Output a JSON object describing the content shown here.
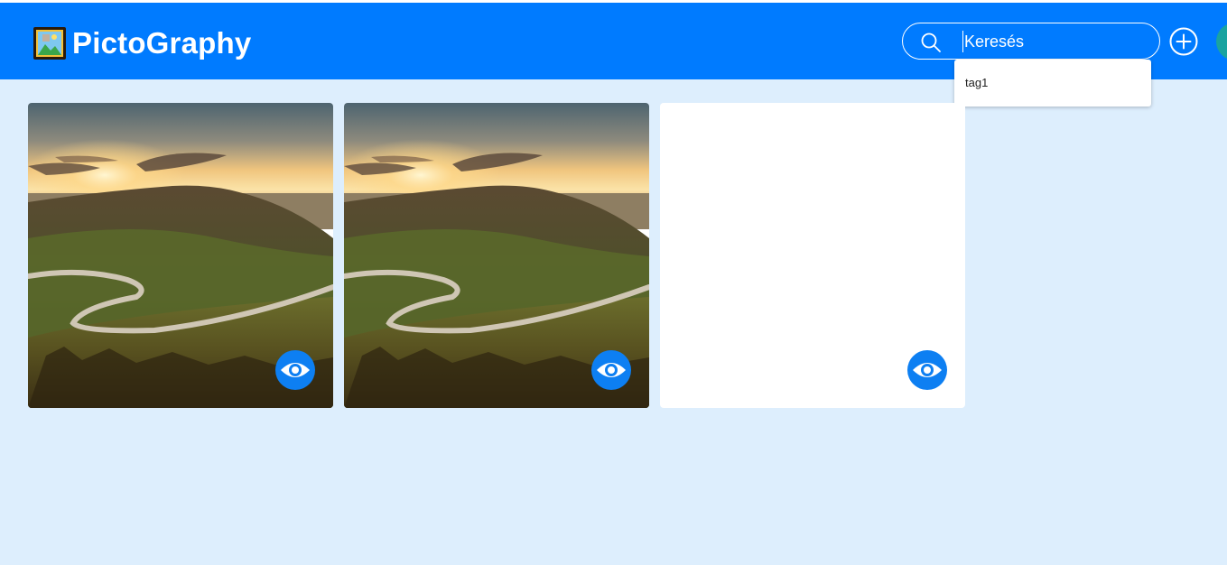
{
  "app": {
    "title": "PictoGraphy",
    "logo_icon": "framed-picture-icon",
    "accent_color": "#007bff",
    "background_color": "#ddeefd"
  },
  "header": {
    "search": {
      "placeholder": "Keresés",
      "value": "",
      "icon": "search-icon"
    },
    "add_button_icon": "plus-circle-icon",
    "avatar_color": "#1aa3a0"
  },
  "search_suggestions": [
    "tag1"
  ],
  "gallery": {
    "images": [
      {
        "type": "landscape-photo",
        "action_icon": "eye-icon"
      },
      {
        "type": "landscape-photo",
        "action_icon": "eye-icon"
      },
      {
        "type": "blank",
        "action_icon": "eye-icon"
      }
    ]
  }
}
